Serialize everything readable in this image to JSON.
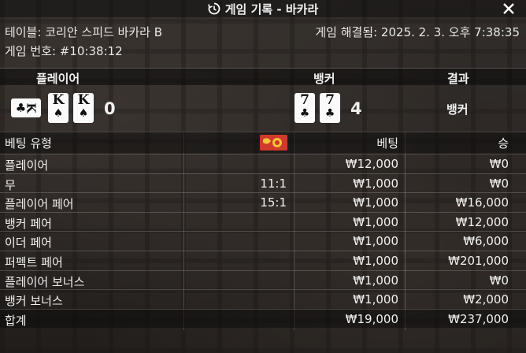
{
  "title": "게임 기록 - 바카라",
  "table_info": "테이블: 코리안 스피드 바카라 B",
  "game_number": "게임 번호: #10:38:12",
  "resolved": "게임 해결됨: 2025. 2. 3. 오후 7:38:35",
  "headers": {
    "player": "플레이어",
    "banker": "뱅커",
    "result": "결과"
  },
  "player": {
    "cards": [
      {
        "rank": "K",
        "suit": "♣",
        "sideways": true
      },
      {
        "rank": "K",
        "suit": "♠"
      },
      {
        "rank": "K",
        "suit": "♠"
      }
    ],
    "score": "0"
  },
  "banker": {
    "cards": [
      {
        "rank": "7",
        "suit": "♣"
      },
      {
        "rank": "7",
        "suit": "♣"
      }
    ],
    "score": "4"
  },
  "result_value": "뱅커",
  "bets_header": {
    "type": "베팅 유형",
    "bet": "베팅",
    "win": "승"
  },
  "bets": [
    {
      "type": "플레이어",
      "odds": "",
      "bet": "₩12,000",
      "win": "₩0"
    },
    {
      "type": "무",
      "odds": "11:1",
      "bet": "₩1,000",
      "win": "₩0"
    },
    {
      "type": "플레이어 페어",
      "odds": "15:1",
      "bet": "₩1,000",
      "win": "₩16,000"
    },
    {
      "type": "뱅커 페어",
      "odds": "",
      "bet": "₩1,000",
      "win": "₩12,000"
    },
    {
      "type": "이더 페어",
      "odds": "",
      "bet": "₩1,000",
      "win": "₩6,000"
    },
    {
      "type": "퍼펙트 페어",
      "odds": "",
      "bet": "₩1,000",
      "win": "₩201,000"
    },
    {
      "type": "플레이어 보너스",
      "odds": "",
      "bet": "₩1,000",
      "win": "₩0"
    },
    {
      "type": "뱅커 보너스",
      "odds": "",
      "bet": "₩1,000",
      "win": "₩2,000"
    }
  ],
  "total": {
    "type": "합계",
    "bet": "₩19,000",
    "win": "₩237,000"
  },
  "colors": {
    "chip": "#d03a2a",
    "card": "#fafafa"
  },
  "icons": {
    "history": "history-icon",
    "close": "close-icon",
    "chip": "chip-icon"
  }
}
